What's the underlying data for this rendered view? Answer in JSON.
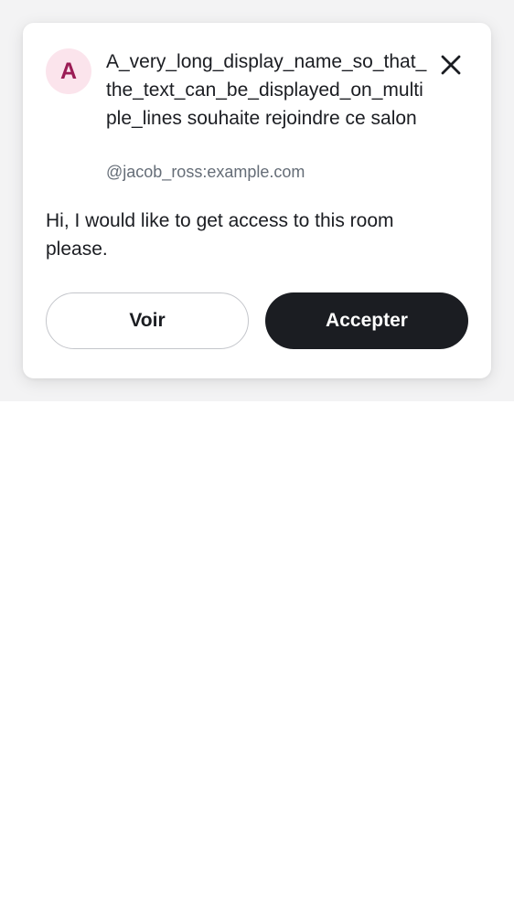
{
  "request": {
    "avatar_letter": "A",
    "title": "A_very_long_display_name_so_that_the_text_can_be_displayed_on_multiple_lines souhaite rejoindre ce salon",
    "user_id": "@jacob_ross:example.com",
    "message": "Hi, I would like to get access to this room please."
  },
  "actions": {
    "view_label": "Voir",
    "accept_label": "Accepter",
    "close_icon": "close-icon"
  },
  "colors": {
    "avatar_bg": "#fbe4ec",
    "avatar_fg": "#9b1c55",
    "primary_button": "#1b1d22",
    "secondary_text": "#656d77"
  }
}
